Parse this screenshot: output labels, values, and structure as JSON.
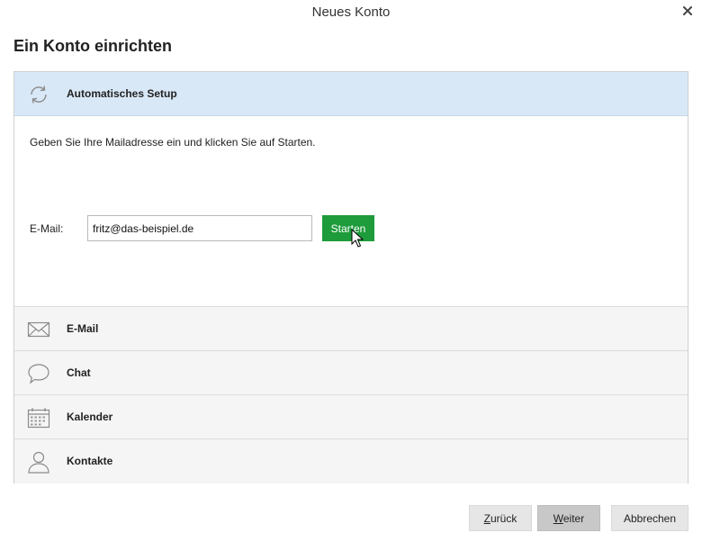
{
  "window": {
    "title": "Neues Konto",
    "close_icon": "close-icon"
  },
  "page": {
    "heading": "Ein Konto einrichten"
  },
  "sections": {
    "auto_setup": {
      "label": "Automatisches Setup",
      "icon": "refresh-icon",
      "expanded": true,
      "instructions": "Geben Sie Ihre Mailadresse ein und klicken Sie auf Starten.",
      "email_label": "E-Mail:",
      "email_value": "fritz@das-beispiel.de",
      "start_label": "Starten",
      "start_color": "#1e9b3b"
    },
    "email": {
      "label": "E-Mail",
      "icon": "envelope-icon"
    },
    "chat": {
      "label": "Chat",
      "icon": "speech-bubble-icon"
    },
    "calendar": {
      "label": "Kalender",
      "icon": "calendar-icon"
    },
    "contacts": {
      "label": "Kontakte",
      "icon": "person-icon"
    }
  },
  "footer": {
    "back_label_first": "Z",
    "back_label_rest": "urück",
    "next_label_first": "W",
    "next_label_rest": "eiter",
    "cancel_label": "Abbrechen"
  },
  "colors": {
    "active_section_bg": "#d9e8f7",
    "section_bg": "#f5f5f5",
    "primary_button": "#1e9b3b"
  }
}
